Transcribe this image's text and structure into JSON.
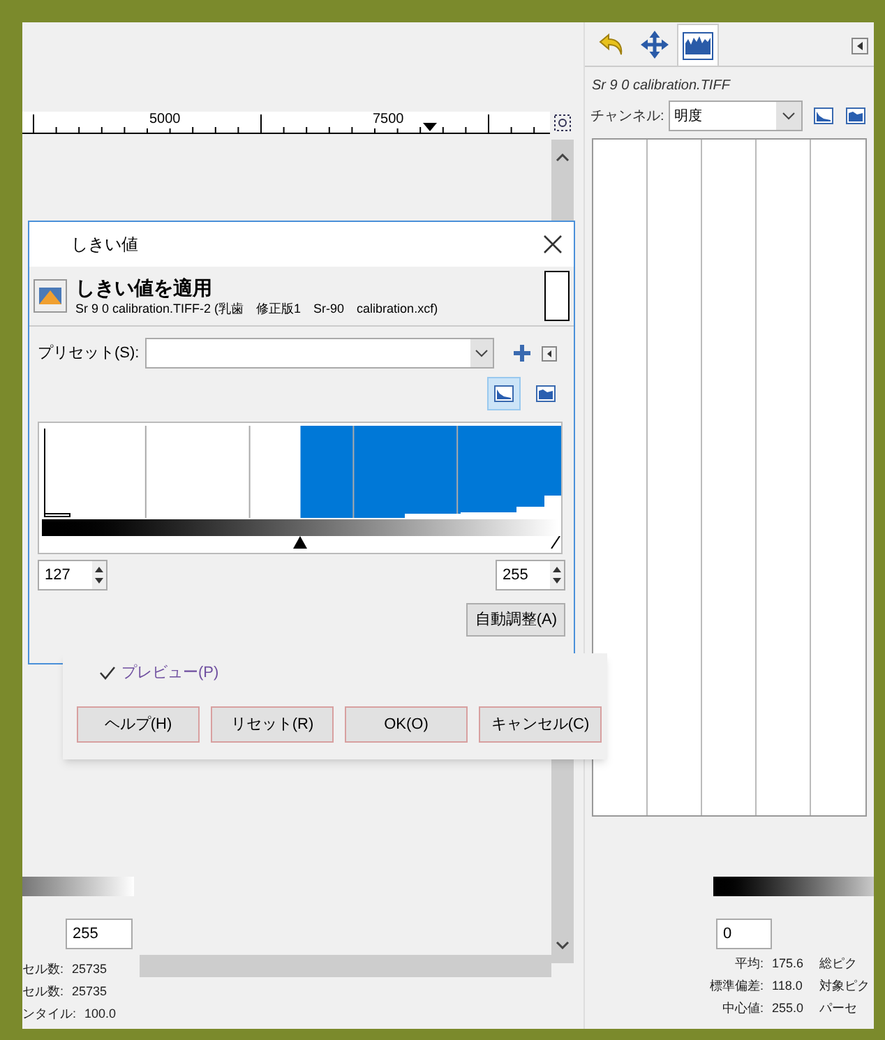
{
  "ruler": {
    "labels": [
      "5000",
      "7500"
    ]
  },
  "dock": {
    "tabs": [
      {
        "kind": "undo",
        "selected": false
      },
      {
        "kind": "move",
        "selected": false
      },
      {
        "kind": "histogram",
        "selected": true
      }
    ],
    "image_title": "Sr 9  0 calibration.TIFF",
    "channel_label": "チャンネル:",
    "channel_value": "明度",
    "scale_buttons": [
      {
        "kind": "linear",
        "selected": false
      },
      {
        "kind": "log",
        "selected": false
      }
    ],
    "input_value": "0",
    "stats": [
      {
        "label": "平均:",
        "value": "175.6",
        "label_2": "総ピク"
      },
      {
        "label": "標準偏差:",
        "value": "118.0",
        "label_2": "対象ピク"
      },
      {
        "label": "中心値:",
        "value": "255.0",
        "label_2": "パーセ"
      }
    ]
  },
  "background_histogram": {
    "input_value": "255",
    "stats": [
      {
        "label": "セル数:",
        "value": "25735"
      },
      {
        "label": "セル数:",
        "value": "25735"
      },
      {
        "label": "ンタイル:",
        "value": "100.0"
      }
    ]
  },
  "dialog": {
    "title": "しきい値",
    "heading": "しきい値を適用",
    "subtitle": "Sr 9  0 calibration.TIFF-2 (乳歯　修正版1　Sr-90　calibration.xcf)",
    "preset_label": "プリセット(S):",
    "scale_buttons": [
      {
        "kind": "linear",
        "selected": true
      },
      {
        "kind": "log",
        "selected": false
      }
    ],
    "low": {
      "value": "127",
      "level": 0.498
    },
    "high": {
      "value": "255",
      "level": 1
    },
    "auto_button": "自動調整(A)",
    "preview": {
      "label": "プレビュー(P)",
      "checked": true
    },
    "buttons": [
      "ヘルプ(H)",
      "リセット(R)",
      "OK(O)",
      "キャンセル(C)"
    ]
  }
}
